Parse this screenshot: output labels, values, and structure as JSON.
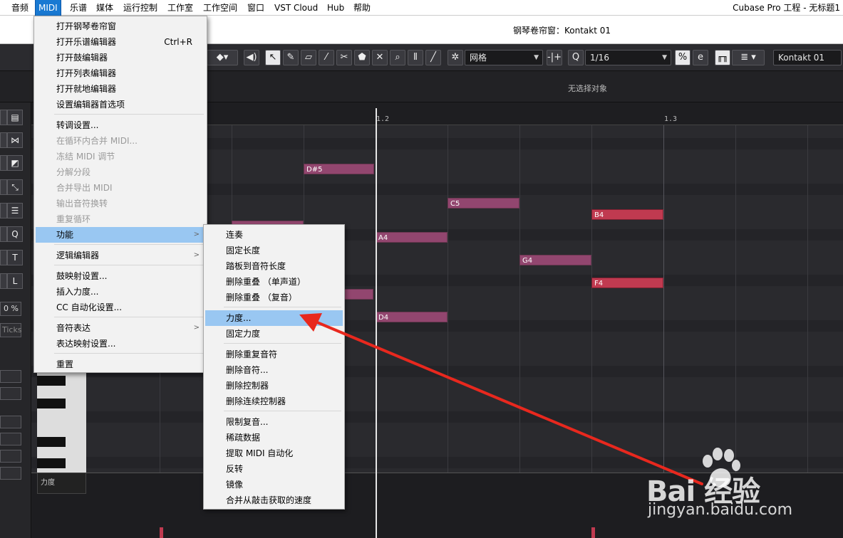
{
  "menubar": {
    "items": [
      "音频",
      "MIDI",
      "乐谱",
      "媒体",
      "运行控制",
      "工作室",
      "工作空间",
      "窗口",
      "VST Cloud",
      "Hub",
      "帮助"
    ],
    "app_title": "Cubase Pro 工程 - 无标题1"
  },
  "window": {
    "title": "钢琴卷帘窗：Kontakt 01"
  },
  "toolbar": {
    "grid_type": "网格",
    "quantize_value": "1/16",
    "instrument": "Kontakt 01"
  },
  "info": {
    "status": "无选择对象"
  },
  "left_panel": {
    "velocity_percent": "0 %",
    "ticks_label": "Ticks"
  },
  "ruler": {
    "labels": [
      "1.2",
      "1.3"
    ]
  },
  "notes": [
    "D#5",
    "C5",
    "B4",
    "A4",
    "G4",
    "F4",
    "D4"
  ],
  "velocity_lane": {
    "label": "力度"
  },
  "midi_menu": {
    "items": [
      {
        "label": "打开钢琴卷帘窗"
      },
      {
        "label": "打开乐谱编辑器",
        "shortcut": "Ctrl+R"
      },
      {
        "label": "打开鼓编辑器"
      },
      {
        "label": "打开列表编辑器"
      },
      {
        "label": "打开就地编辑器"
      },
      {
        "label": "设置编辑器首选项"
      },
      {
        "label": "转调设置..."
      },
      {
        "label": "在循环内合并 MIDI..."
      },
      {
        "label": "冻结 MIDI 调节"
      },
      {
        "label": "分解分段"
      },
      {
        "label": "合并导出 MIDI"
      },
      {
        "label": "输出音符换转"
      },
      {
        "label": "重复循环"
      },
      {
        "label": "功能"
      },
      {
        "label": "逻辑编辑器"
      },
      {
        "label": "鼓映射设置..."
      },
      {
        "label": "插入力度..."
      },
      {
        "label": "CC 自动化设置..."
      },
      {
        "label": "音符表达"
      },
      {
        "label": "表达映射设置..."
      },
      {
        "label": "重置"
      }
    ]
  },
  "functions_submenu": {
    "items": [
      {
        "label": "连奏"
      },
      {
        "label": "固定长度"
      },
      {
        "label": "踏板到音符长度"
      },
      {
        "label": "删除重叠 （单声道）"
      },
      {
        "label": "删除重叠 （复音）"
      },
      {
        "label": "力度..."
      },
      {
        "label": "固定力度"
      },
      {
        "label": "删除重复音符"
      },
      {
        "label": "删除音符..."
      },
      {
        "label": "删除控制器"
      },
      {
        "label": "删除连续控制器"
      },
      {
        "label": "限制复音..."
      },
      {
        "label": "稀疏数据"
      },
      {
        "label": "提取 MIDI 自动化"
      },
      {
        "label": "反转"
      },
      {
        "label": "镜像"
      },
      {
        "label": "合并从敲击获取的速度"
      }
    ]
  },
  "watermark": {
    "logo": "Bai  经验",
    "url": "jingyan.baidu.com"
  },
  "colors": {
    "menu_highlight": "#99c7f2",
    "accent": "#1979d2",
    "note_purple": "#92466f",
    "note_red": "#c03a50",
    "arrow": "#e8281e"
  }
}
